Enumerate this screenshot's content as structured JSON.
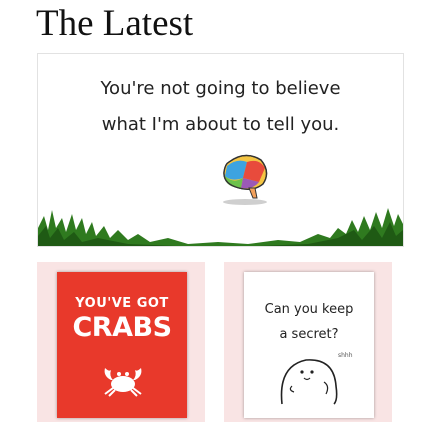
{
  "section": {
    "title": "The Latest"
  },
  "featured": {
    "line1": "You're not going to believe",
    "line2": "what I'm about to tell you.",
    "icon": "brain-icon"
  },
  "cards": [
    {
      "top_text": "YOU'VE GOT",
      "big_text": "CRABS",
      "icon": "crab-icon",
      "bg_color": "#e8392b"
    },
    {
      "line1": "Can you keep",
      "line2": "a secret?",
      "whisper": "shhh",
      "icon": "blob-creature-icon"
    }
  ],
  "colors": {
    "card_bg": "#f9e4e4",
    "accent": "#e8392b"
  }
}
